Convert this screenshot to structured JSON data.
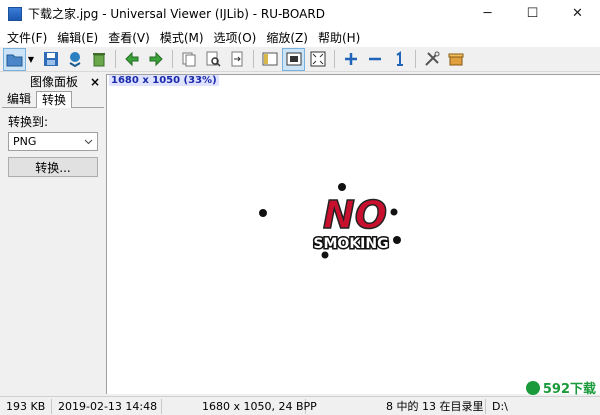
{
  "window": {
    "title": "下载之家.jpg - Universal Viewer (IJLib) - RU-BOARD",
    "minimize": "─",
    "maximize": "☐",
    "close": "✕"
  },
  "menu": [
    "文件(F)",
    "编辑(E)",
    "查看(V)",
    "模式(M)",
    "选项(O)",
    "缩放(Z)",
    "帮助(H)"
  ],
  "panel": {
    "title": "图像面板",
    "close": "×",
    "tabs": [
      "编辑",
      "转换"
    ],
    "active_tab": "转换",
    "convert_label": "转换到:",
    "format_value": "PNG",
    "convert_button": "转换..."
  },
  "view": {
    "image_info": "1680 x 1050 (33%)",
    "logo_top": "NO",
    "logo_bottom": "SMOKING"
  },
  "status": {
    "size": "193 KB",
    "date": "2019-02-13 14:48",
    "dimensions": "1680 x 1050, 24 BPP",
    "position": "8 中的 13 在目录里",
    "path": "D:\\"
  },
  "watermark": "592下载",
  "colors": {
    "accent": "#1a2aa8",
    "logo_red": "#c8102e"
  }
}
